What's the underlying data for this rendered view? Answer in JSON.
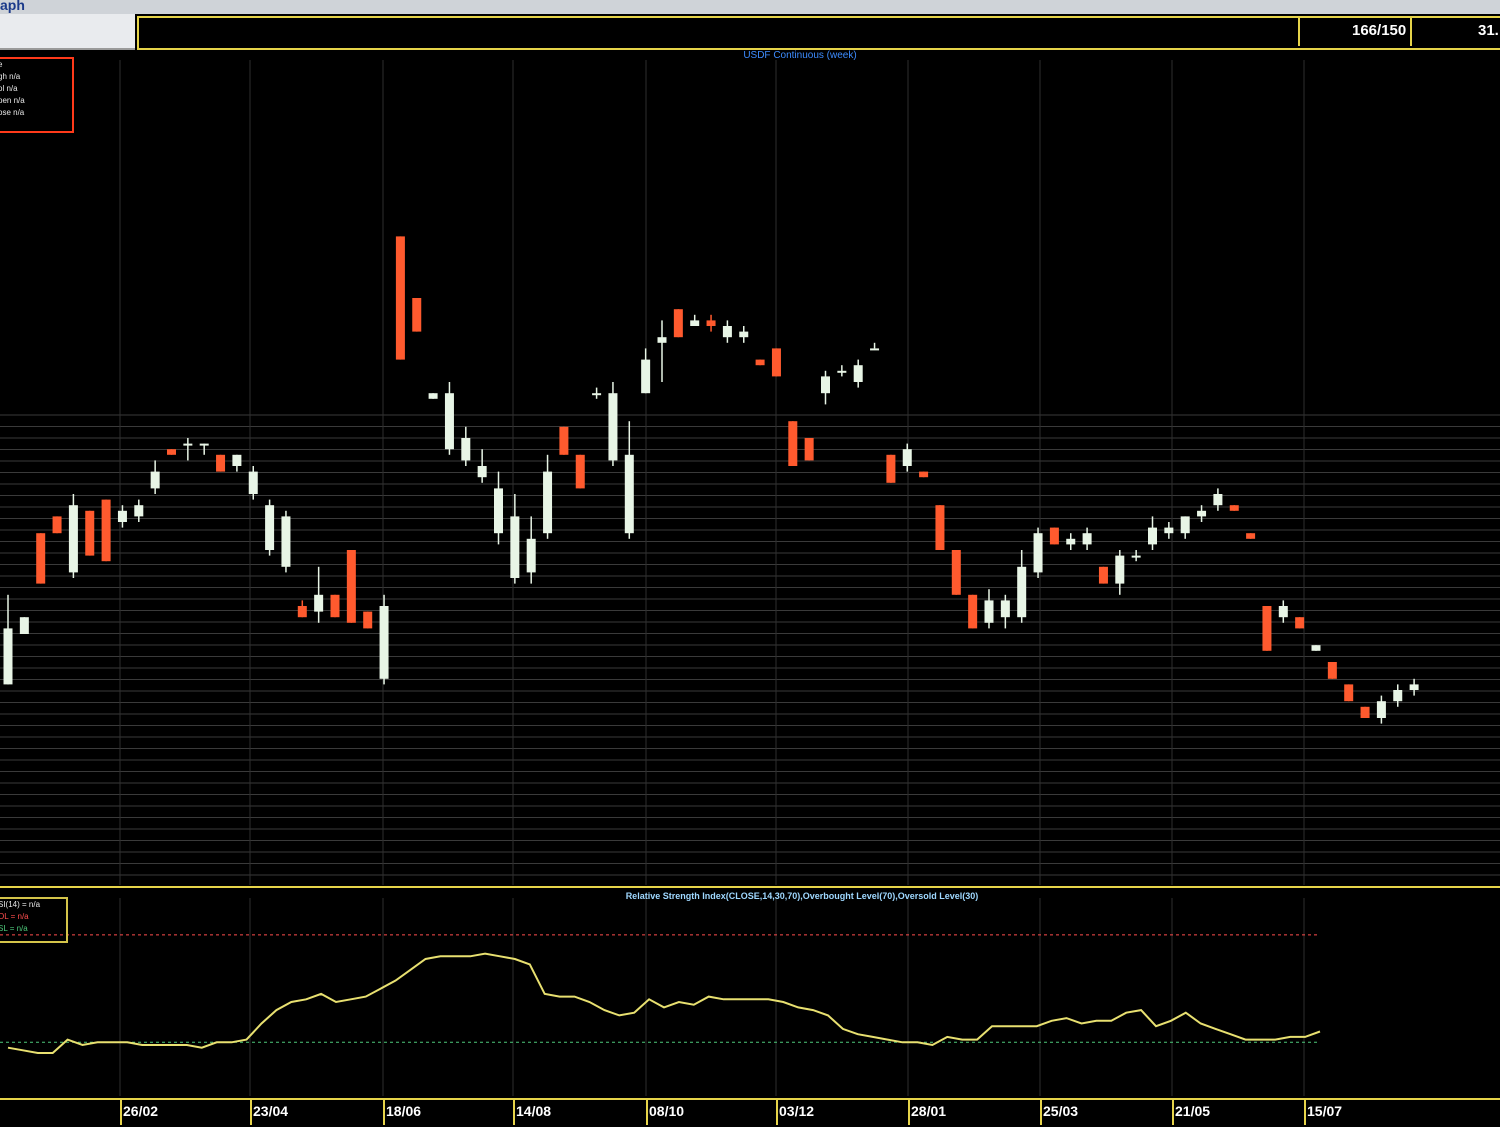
{
  "window": {
    "title_fragment": "aph"
  },
  "toolbar": {
    "ratio": "166/150",
    "value_fragment": "31."
  },
  "legend": {
    "lines": [
      "e",
      "gh n/a",
      "ol n/a",
      "pen n/a",
      "ose n/a"
    ]
  },
  "rsi_legend": {
    "lines": [
      "SI(14) = n/a",
      "OL = n/a",
      "SL = n/a"
    ]
  },
  "colors": {
    "up": "#e8f5e6",
    "down": "#ff5a2e",
    "rsi_line": "#e8e070",
    "overbought": "#ff4d4d",
    "oversold": "#4dc87a",
    "border": "#e6d44a",
    "grid": "#3a3a3a"
  },
  "chart_data": [
    {
      "type": "candlestick",
      "title": "USDF Continuous (week)",
      "x_tick_labels": [
        "26/02",
        "23/04",
        "18/06",
        "14/08",
        "08/10",
        "03/12",
        "28/01",
        "25/03",
        "21/05",
        "15/07"
      ],
      "candles": [
        [
          0,
          0.06,
          0.16,
          0.22,
          0.22
        ],
        [
          1,
          0.15,
          0.18,
          0.16,
          0.15
        ],
        [
          2,
          0.33,
          0.24,
          0.23,
          0.33
        ],
        [
          3,
          0.36,
          0.33,
          0.31,
          0.38
        ],
        [
          4,
          0.26,
          0.38,
          0.4,
          0.25
        ],
        [
          5,
          0.37,
          0.29,
          0.27,
          0.37
        ],
        [
          6,
          0.39,
          0.28,
          0.25,
          0.41
        ],
        [
          7,
          0.35,
          0.37,
          0.38,
          0.34
        ],
        [
          8,
          0.36,
          0.38,
          0.39,
          0.35
        ],
        [
          9,
          0.41,
          0.44,
          0.46,
          0.4
        ],
        [
          10,
          0.48,
          0.47,
          0.48,
          0.48
        ],
        [
          11,
          0.49,
          0.49,
          0.5,
          0.46
        ],
        [
          12,
          0.49,
          0.49,
          0.49,
          0.47
        ],
        [
          13,
          0.47,
          0.44,
          0.46,
          0.45
        ],
        [
          14,
          0.45,
          0.47,
          0.47,
          0.44
        ],
        [
          15,
          0.4,
          0.44,
          0.45,
          0.39
        ],
        [
          16,
          0.3,
          0.38,
          0.39,
          0.29
        ],
        [
          17,
          0.27,
          0.36,
          0.37,
          0.26
        ],
        [
          18,
          0.2,
          0.18,
          0.21,
          0.26
        ],
        [
          19,
          0.19,
          0.22,
          0.27,
          0.17
        ],
        [
          20,
          0.22,
          0.18,
          0.17,
          0.24
        ],
        [
          21,
          0.3,
          0.17,
          0.15,
          0.34
        ],
        [
          22,
          0.19,
          0.16,
          0.15,
          0.24
        ],
        [
          23,
          0.07,
          0.2,
          0.22,
          0.06
        ],
        [
          24,
          0.86,
          0.64,
          0.63,
          0.86
        ],
        [
          25,
          0.75,
          0.69,
          0.68,
          0.78
        ],
        [
          26,
          0.57,
          0.58,
          0.58,
          0.57
        ],
        [
          27,
          0.48,
          0.58,
          0.6,
          0.47
        ],
        [
          28,
          0.46,
          0.5,
          0.52,
          0.45
        ],
        [
          29,
          0.43,
          0.45,
          0.48,
          0.42
        ],
        [
          30,
          0.33,
          0.41,
          0.44,
          0.31
        ],
        [
          31,
          0.25,
          0.36,
          0.4,
          0.24
        ],
        [
          32,
          0.26,
          0.32,
          0.36,
          0.24
        ],
        [
          33,
          0.33,
          0.44,
          0.47,
          0.32
        ],
        [
          34,
          0.52,
          0.47,
          0.48,
          0.52
        ],
        [
          35,
          0.47,
          0.41,
          0.39,
          0.54
        ],
        [
          36,
          0.58,
          0.58,
          0.59,
          0.57
        ],
        [
          37,
          0.46,
          0.58,
          0.6,
          0.45
        ],
        [
          38,
          0.33,
          0.47,
          0.53,
          0.32
        ],
        [
          39,
          0.58,
          0.64,
          0.66,
          0.58
        ],
        [
          40,
          0.67,
          0.68,
          0.71,
          0.6
        ],
        [
          41,
          0.73,
          0.68,
          0.67,
          0.75
        ],
        [
          42,
          0.7,
          0.71,
          0.72,
          0.7
        ],
        [
          43,
          0.71,
          0.7,
          0.72,
          0.69
        ],
        [
          44,
          0.68,
          0.7,
          0.71,
          0.67
        ],
        [
          45,
          0.68,
          0.69,
          0.7,
          0.67
        ],
        [
          46,
          0.64,
          0.63,
          0.64,
          0.65
        ],
        [
          47,
          0.66,
          0.61,
          0.6,
          0.67
        ],
        [
          48,
          0.53,
          0.45,
          0.44,
          0.55
        ],
        [
          49,
          0.5,
          0.46,
          0.45,
          0.53
        ],
        [
          50,
          0.58,
          0.61,
          0.62,
          0.56
        ],
        [
          51,
          0.62,
          0.62,
          0.63,
          0.61
        ],
        [
          52,
          0.6,
          0.63,
          0.64,
          0.59
        ],
        [
          53,
          0.66,
          0.66,
          0.67,
          0.66
        ],
        [
          54,
          0.47,
          0.42,
          0.42,
          0.48
        ],
        [
          55,
          0.45,
          0.48,
          0.49,
          0.44
        ],
        [
          56,
          0.44,
          0.43,
          0.43,
          0.46
        ],
        [
          57,
          0.38,
          0.3,
          0.29,
          0.42
        ],
        [
          58,
          0.3,
          0.22,
          0.19,
          0.32
        ],
        [
          59,
          0.22,
          0.16,
          0.15,
          0.24
        ],
        [
          60,
          0.17,
          0.21,
          0.23,
          0.16
        ],
        [
          61,
          0.18,
          0.21,
          0.22,
          0.16
        ],
        [
          62,
          0.18,
          0.27,
          0.3,
          0.17
        ],
        [
          63,
          0.26,
          0.33,
          0.34,
          0.25
        ],
        [
          64,
          0.34,
          0.31,
          0.29,
          0.35
        ],
        [
          65,
          0.31,
          0.32,
          0.33,
          0.3
        ],
        [
          66,
          0.31,
          0.33,
          0.34,
          0.3
        ],
        [
          67,
          0.27,
          0.24,
          0.23,
          0.28
        ],
        [
          68,
          0.24,
          0.29,
          0.3,
          0.22
        ],
        [
          69,
          0.29,
          0.29,
          0.3,
          0.28
        ],
        [
          70,
          0.31,
          0.34,
          0.36,
          0.3
        ],
        [
          71,
          0.33,
          0.34,
          0.35,
          0.32
        ],
        [
          72,
          0.33,
          0.36,
          0.36,
          0.32
        ],
        [
          73,
          0.36,
          0.37,
          0.38,
          0.35
        ],
        [
          74,
          0.38,
          0.4,
          0.41,
          0.37
        ],
        [
          75,
          0.38,
          0.37,
          0.36,
          0.39
        ],
        [
          76,
          0.33,
          0.32,
          0.31,
          0.34
        ],
        [
          77,
          0.2,
          0.12,
          0.11,
          0.22
        ],
        [
          78,
          0.18,
          0.2,
          0.21,
          0.17
        ],
        [
          79,
          0.18,
          0.16,
          0.14,
          0.19
        ],
        [
          80,
          0.12,
          0.13,
          0.13,
          0.12
        ],
        [
          81,
          0.1,
          0.07,
          0.06,
          0.11
        ],
        [
          82,
          0.06,
          0.03,
          0.02,
          0.07
        ],
        [
          83,
          0.02,
          0.0,
          -0.01,
          0.03
        ],
        [
          84,
          0.0,
          0.03,
          0.04,
          -0.01
        ],
        [
          85,
          0.03,
          0.05,
          0.06,
          0.02
        ],
        [
          86,
          0.05,
          0.06,
          0.07,
          0.04
        ]
      ],
      "candles_format": "[index, open, close, high(top), low(bottom)] — open/close/high/low are read as relative price levels on an unlabeled axis; values shown are approximate",
      "y_axis_labels": []
    },
    {
      "type": "line",
      "title": "Relative Strength Index(CLOSE,14,30,70),Overbought Level(70),Oversold Level(30)",
      "overbought": 70,
      "oversold": 30,
      "series": [
        {
          "values": [
            28,
            27,
            26,
            26,
            31,
            29,
            30,
            30,
            30,
            29,
            29,
            29,
            29,
            28,
            30,
            30,
            31,
            37,
            42,
            45,
            46,
            48,
            45,
            46,
            47,
            50,
            53,
            57,
            61,
            62,
            62,
            62,
            63,
            62,
            61,
            59,
            48,
            47,
            47,
            45,
            42,
            40,
            41,
            46,
            43,
            45,
            44,
            47,
            46,
            46,
            46,
            46,
            45,
            43,
            42,
            40,
            35,
            33,
            32,
            31,
            30,
            30,
            29,
            32,
            31,
            31,
            36,
            36,
            36,
            36,
            38,
            39,
            37,
            38,
            38,
            41,
            42,
            36,
            38,
            41,
            37,
            35,
            33,
            31,
            31,
            31,
            32,
            32,
            34
          ]
        }
      ]
    }
  ]
}
